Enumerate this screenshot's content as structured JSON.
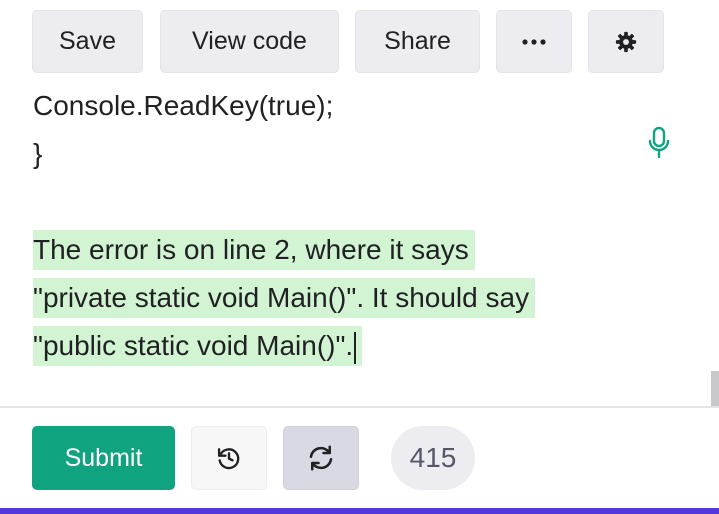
{
  "toolbar": {
    "save_label": "Save",
    "view_code_label": "View code",
    "share_label": "Share",
    "more_icon": "more-dots-icon",
    "settings_icon": "gear-icon"
  },
  "editor": {
    "code_lines": [
      "Console.ReadKey(true);",
      "}"
    ],
    "response_lines": [
      "The error is on line 2, where it says",
      "\"private static void Main()\". It should say",
      "\"public static void Main()\"."
    ],
    "mic_icon": "microphone-icon",
    "highlight_color": "#d2f4d3",
    "mic_color": "#10a37f"
  },
  "bottom": {
    "submit_label": "Submit",
    "undo_icon": "undo-icon",
    "regenerate_icon": "regenerate-icon",
    "token_count": "415",
    "accent_color": "#10a37f",
    "bar_color": "#5436da"
  }
}
